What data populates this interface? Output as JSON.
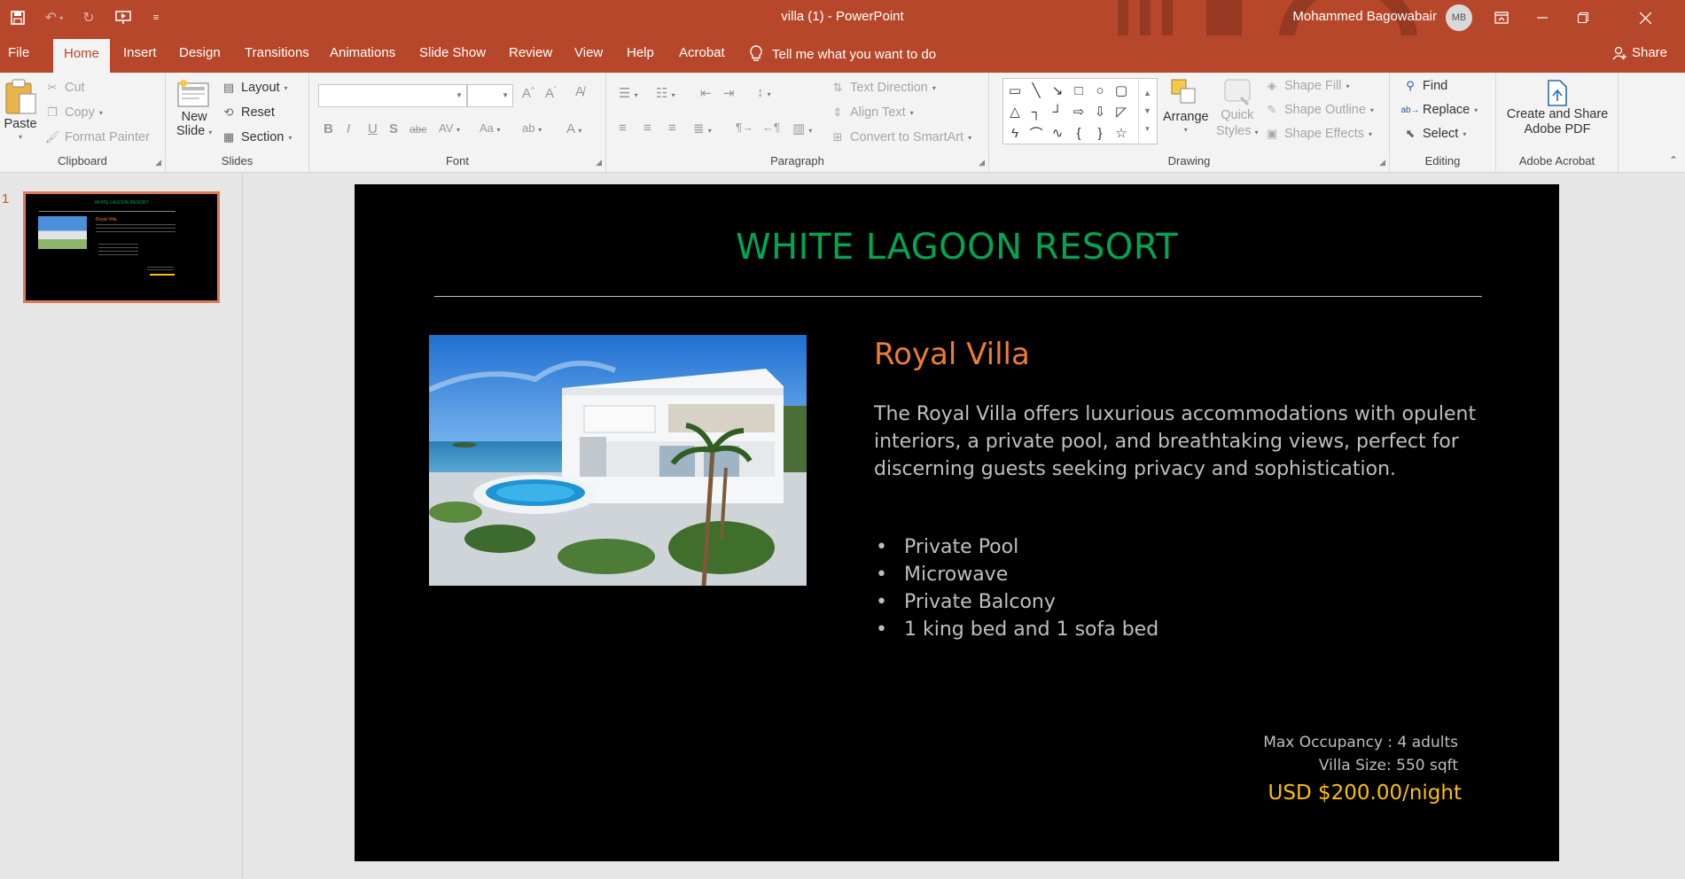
{
  "window": {
    "title": "villa (1)  -  PowerPoint",
    "user": "Mohammed Bagowabair",
    "avatar_initials": "MB"
  },
  "tabs": [
    {
      "label": "File"
    },
    {
      "label": "Home"
    },
    {
      "label": "Insert"
    },
    {
      "label": "Design"
    },
    {
      "label": "Transitions"
    },
    {
      "label": "Animations"
    },
    {
      "label": "Slide Show"
    },
    {
      "label": "Review"
    },
    {
      "label": "View"
    },
    {
      "label": "Help"
    },
    {
      "label": "Acrobat"
    }
  ],
  "active_tab": "Home",
  "tellme": "Tell me what you want to do",
  "share": "Share",
  "ribbon": {
    "clipboard": {
      "label": "Clipboard",
      "paste": "Paste",
      "cut": "Cut",
      "copy": "Copy",
      "format_painter": "Format Painter"
    },
    "slides": {
      "label": "Slides",
      "new_slide_1": "New",
      "new_slide_2": "Slide",
      "layout": "Layout",
      "reset": "Reset",
      "section": "Section"
    },
    "font": {
      "label": "Font"
    },
    "paragraph": {
      "label": "Paragraph",
      "text_direction": "Text Direction",
      "align_text": "Align Text",
      "convert_smartart": "Convert to SmartArt"
    },
    "drawing": {
      "label": "Drawing",
      "arrange": "Arrange",
      "quick_styles_1": "Quick",
      "quick_styles_2": "Styles",
      "shape_fill": "Shape Fill",
      "shape_outline": "Shape Outline",
      "shape_effects": "Shape Effects"
    },
    "editing": {
      "label": "Editing",
      "find": "Find",
      "replace": "Replace",
      "select": "Select"
    },
    "acrobat": {
      "label": "Adobe Acrobat",
      "create_1": "Create and Share",
      "create_2": "Adobe PDF"
    }
  },
  "thumbnail": {
    "number": "1"
  },
  "slide": {
    "title": "WHITE LAGOON RESORT",
    "villa_name": "Royal Villa",
    "description": "The Royal Villa offers luxurious accommodations with opulent interiors, a private pool, and breathtaking views, perfect for discerning guests seeking privacy and sophistication.",
    "amenities": [
      "Private Pool",
      "Microwave",
      "Private Balcony",
      "1 king bed and 1 sofa bed"
    ],
    "occupancy": "Max Occupancy : 4 adults",
    "size": "Villa Size: 550 sqft",
    "price": "USD $200.00/night"
  },
  "colors": {
    "accent": "#b7472a",
    "title_green": "#00a651",
    "villa_orange": "#ed7d31",
    "price_gold": "#ffc000",
    "body_gray": "#bfbfbf"
  }
}
